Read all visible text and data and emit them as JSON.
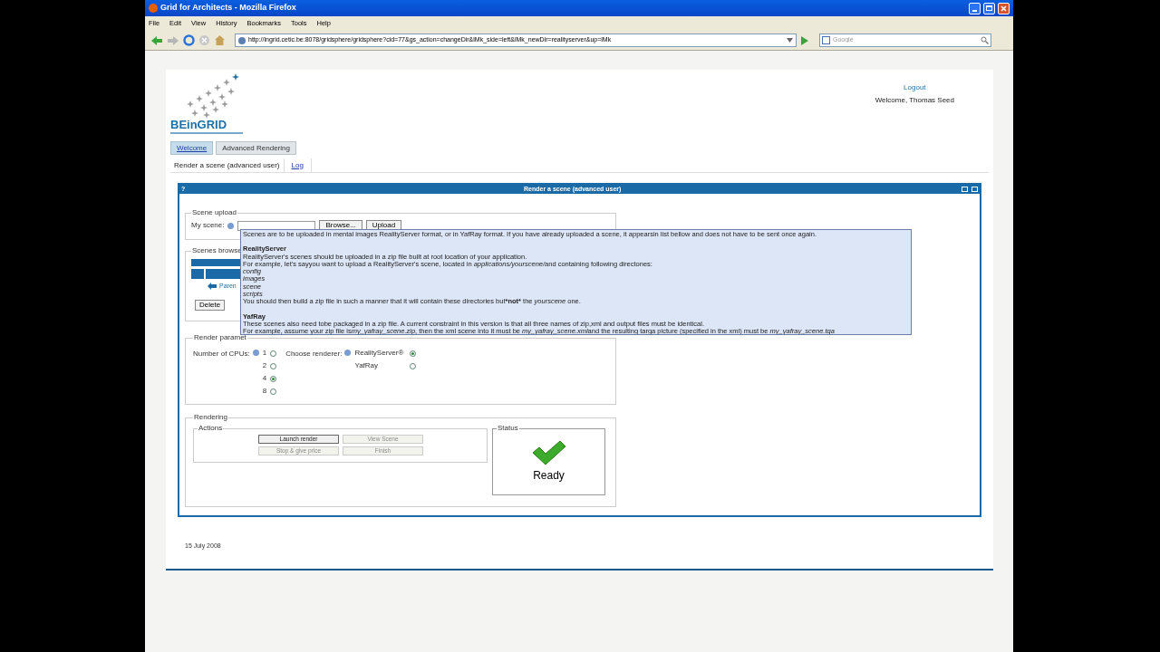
{
  "window": {
    "title": "Grid for Architects - Mozilla Firefox"
  },
  "menu": [
    "File",
    "Edit",
    "View",
    "History",
    "Bookmarks",
    "Tools",
    "Help"
  ],
  "address_bar": {
    "url": "http://ingrid.cetic.be:8078/gridsphere/gridsphere?cid=77&gs_action=changeDir&lMk_side=left&lMk_newDir=realityserver&up=lMk"
  },
  "search": {
    "placeholder": "Google"
  },
  "logo": "BEinGRID",
  "user": {
    "logout": "Logout",
    "welcome": "Welcome, Thomas Seed"
  },
  "tabs": [
    {
      "label": "Welcome",
      "selected": true
    },
    {
      "label": "Advanced Rendering",
      "selected": false
    }
  ],
  "subtabs": [
    {
      "label": "Render a scene (advanced user)",
      "selected": true
    },
    {
      "label": "Log",
      "selected": false
    }
  ],
  "portlet": {
    "help": "?",
    "title": "Render a scene (advanced user)"
  },
  "scene_upload": {
    "legend": "Scene upload",
    "label": "My scene:",
    "browse": "Browse...",
    "upload": "Upload"
  },
  "scenes_browser": {
    "legend": "Scenes browse",
    "parent_link": "Paren",
    "delete": "Delete"
  },
  "tooltip": {
    "intro": "Scenes are to be uploaded in mental images RealityServer format, or in YafRay format. If you have already uploaded a scene, it appearsin list bellow and does not have to be sent once again.",
    "sections": [
      {
        "heading": "RealityServer",
        "lines": [
          [
            {
              "text": "RealityServer's scenes should be uploaded in a zip file built at root location of your application."
            }
          ],
          [
            {
              "text": "For example, let's sayyou want to upload a RealityServer's scene, located in "
            },
            {
              "text": "applications/yourscene/",
              "kind": "emphasis"
            },
            {
              "text": "and containing following directones:"
            }
          ],
          [
            {
              "text": "config",
              "kind": "emphasis"
            }
          ],
          [
            {
              "text": "images",
              "kind": "emphasis"
            }
          ],
          [
            {
              "text": "scene",
              "kind": "emphasis"
            }
          ],
          [
            {
              "text": "scripts",
              "kind": "emphasis"
            }
          ],
          [
            {
              "text": "You should then build a zip file in such a manner that it will contain these directories but"
            },
            {
              "text": "*not*",
              "kind": "strong"
            },
            {
              "text": " the "
            },
            {
              "text": "yourscene",
              "kind": "emphasis"
            },
            {
              "text": " one."
            }
          ]
        ]
      },
      {
        "heading": "YafRay",
        "lines": [
          [
            {
              "text": "These scenes also need tobe packaged in a zip file. A current constraint in this version is that all three names of zip,xml and output files must be identical."
            }
          ],
          [
            {
              "text": "For example, assume your zip file is"
            },
            {
              "text": "my_yafray_scene.zip",
              "kind": "emphasis"
            },
            {
              "text": ", then the xml scene into it must be "
            },
            {
              "text": "my_yafray_scene.xml",
              "kind": "emphasis"
            },
            {
              "text": "and the resulting targa picture (specified in the xml) must be "
            },
            {
              "text": "my_yafray_scene.tga",
              "kind": "emphasis"
            }
          ]
        ]
      }
    ]
  },
  "render_params": {
    "legend": "Render paramet",
    "cpus": {
      "label": "Number of CPUs:",
      "options": [
        {
          "label": "1",
          "selected": false
        },
        {
          "label": "2",
          "selected": false
        },
        {
          "label": "4",
          "selected": true
        },
        {
          "label": "8",
          "selected": false
        }
      ]
    },
    "renderer": {
      "label": "Choose renderer:",
      "options": [
        {
          "label": "RealityServer®",
          "selected": true
        },
        {
          "label": "YafRay",
          "selected": false
        }
      ]
    }
  },
  "rendering": {
    "legend": "Rendering",
    "actions": {
      "legend": "Actions",
      "buttons": [
        {
          "label": "Launch render",
          "disabled": false
        },
        {
          "label": "View Scene",
          "disabled": true
        },
        {
          "label": "Stop & give price",
          "disabled": true
        },
        {
          "label": "Finish",
          "disabled": true
        }
      ]
    },
    "status": {
      "legend": "Status",
      "text": "Ready"
    }
  },
  "footer": {
    "date": "15 July 2008"
  }
}
